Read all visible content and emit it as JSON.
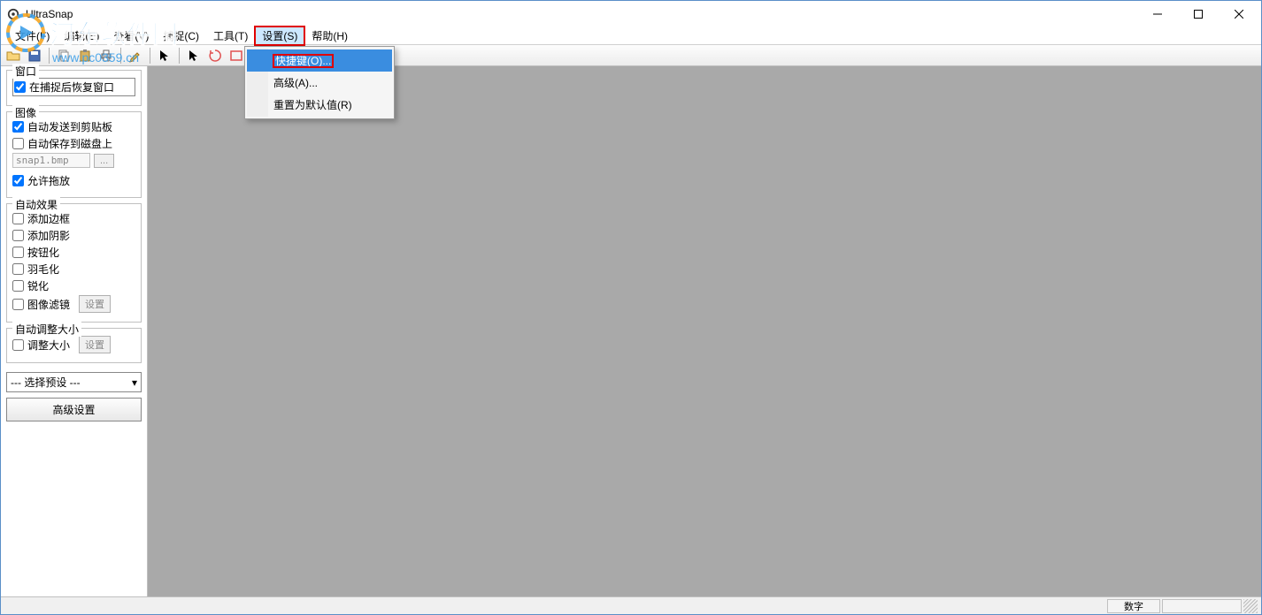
{
  "app": {
    "title": "UltraSnap"
  },
  "watermark": {
    "text": "河东软件园",
    "url": "www.pc0359.cn"
  },
  "menu": {
    "items": [
      {
        "label": "文件(F)"
      },
      {
        "label": "编辑(E)"
      },
      {
        "label": "查看(V)"
      },
      {
        "label": "捕捉(C)"
      },
      {
        "label": "工具(T)"
      },
      {
        "label": "设置(S)",
        "highlighted": true
      },
      {
        "label": "帮助(H)"
      }
    ]
  },
  "settings_menu": {
    "items": [
      {
        "label": "快捷键(O)...",
        "selected": true
      },
      {
        "label": "高级(A)..."
      },
      {
        "label": "重置为默认值(R)"
      }
    ]
  },
  "panel": {
    "window": {
      "legend": "窗口",
      "restore": {
        "label": "在捕捉后恢复窗口",
        "checked": true
      }
    },
    "image": {
      "legend": "图像",
      "clipboard": {
        "label": "自动发送到剪贴板",
        "checked": true
      },
      "disk": {
        "label": "自动保存到磁盘上",
        "checked": false
      },
      "filename": "snap1.bmp",
      "browse": "...",
      "dragdrop": {
        "label": "允许拖放",
        "checked": true
      }
    },
    "effects": {
      "legend": "自动效果",
      "border": {
        "label": "添加边框",
        "checked": false
      },
      "shadow": {
        "label": "添加阴影",
        "checked": false
      },
      "button": {
        "label": "按钮化",
        "checked": false
      },
      "feather": {
        "label": "羽毛化",
        "checked": false
      },
      "sharpen": {
        "label": "锐化",
        "checked": false
      },
      "filter": {
        "label": "图像滤镜",
        "checked": false
      },
      "filter_btn": "设置"
    },
    "resize": {
      "legend": "自动调整大小",
      "resize": {
        "label": "调整大小",
        "checked": false
      },
      "resize_btn": "设置"
    },
    "preset": "--- 选择预设 ---",
    "advanced_btn": "高级设置"
  },
  "status": {
    "numlock": "数字"
  }
}
